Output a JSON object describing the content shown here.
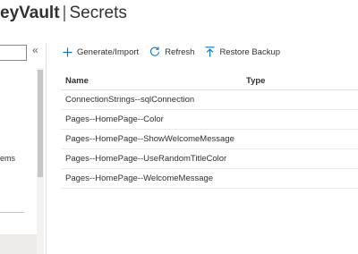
{
  "header": {
    "vault_name": "eyVault",
    "separator": "|",
    "page": "Secrets"
  },
  "left_panel": {
    "search_value": "",
    "collapse_icon": "«",
    "nav_fragment": "ems"
  },
  "toolbar": {
    "generate_label": "Generate/Import",
    "refresh_label": "Refresh",
    "restore_label": "Restore Backup"
  },
  "table": {
    "columns": [
      "Name",
      "Type"
    ],
    "rows": [
      {
        "name": "ConnectionStrings--sqlConnection",
        "type": ""
      },
      {
        "name": "Pages--HomePage--Color",
        "type": ""
      },
      {
        "name": "Pages--HomePage--ShowWelcomeMessage",
        "type": ""
      },
      {
        "name": "Pages--HomePage--UseRandomTitleColor",
        "type": ""
      },
      {
        "name": "Pages--HomePage--WelcomeMessage",
        "type": ""
      }
    ]
  },
  "colors": {
    "accent": "#0078d4",
    "text": "#323130",
    "selected_nav": "#edebe9"
  }
}
